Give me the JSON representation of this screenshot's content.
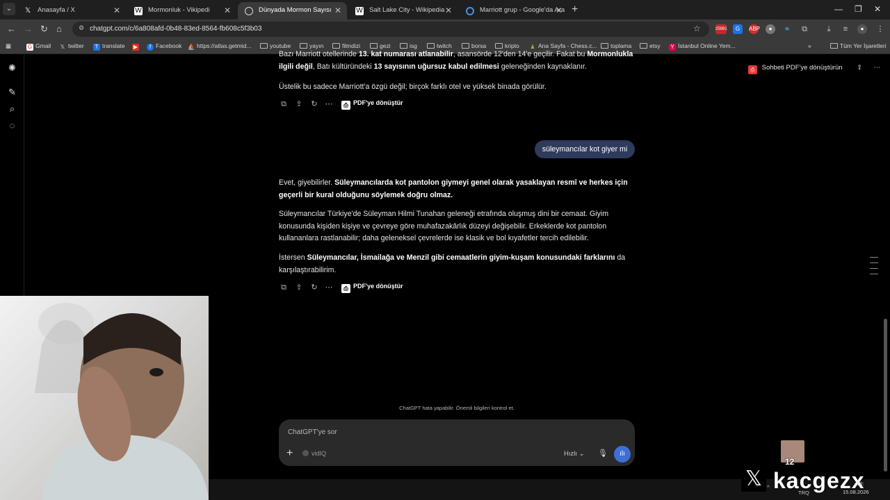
{
  "browser": {
    "tabs": [
      {
        "title": "Anasayfa / X",
        "favicon": "x-logo-icon",
        "active": false
      },
      {
        "title": "Mormonluk - Vikipedi",
        "favicon": "wikipedia-icon",
        "active": false
      },
      {
        "title": "Dünyada Mormon Sayısı",
        "favicon": "chatgpt-icon",
        "active": true
      },
      {
        "title": "Salt Lake City - Wikipedia",
        "favicon": "wikipedia-icon",
        "active": false
      },
      {
        "title": "Marriott grup - Google'da Ara",
        "favicon": "google-icon",
        "active": false
      }
    ],
    "url": "chatgpt.com/c/6a808afd-0b48-83ed-8564-fb608c5f3b03",
    "badge_count": "25981",
    "bookmarks": [
      {
        "label": "Gmail",
        "icon": "gmail-icon"
      },
      {
        "label": "twitter",
        "icon": "x-logo-icon"
      },
      {
        "label": "translate",
        "icon": "translate-icon"
      },
      {
        "label": "",
        "icon": "youtube-icon"
      },
      {
        "label": "Facebook",
        "icon": "facebook-icon"
      },
      {
        "label": "https://atlas.getmid...",
        "icon": "midjourney-icon"
      },
      {
        "label": "youtube",
        "icon": "folder-icon"
      },
      {
        "label": "yayın",
        "icon": "folder-icon"
      },
      {
        "label": "filmdizi",
        "icon": "folder-icon"
      },
      {
        "label": "gezi",
        "icon": "folder-icon"
      },
      {
        "label": "isg",
        "icon": "folder-icon"
      },
      {
        "label": "twitch",
        "icon": "folder-icon"
      },
      {
        "label": "borsa",
        "icon": "folder-icon"
      },
      {
        "label": "kripto",
        "icon": "folder-icon"
      },
      {
        "label": "Ana Sayfa - Chess.c...",
        "icon": "chess-icon"
      },
      {
        "label": "toplama",
        "icon": "folder-icon"
      },
      {
        "label": "etsy",
        "icon": "folder-icon"
      },
      {
        "label": "İstanbul Online Yem...",
        "icon": "yemeksepeti-icon"
      }
    ],
    "all_bookmarks": "Tüm Yer İşaretleri"
  },
  "chat": {
    "top_clipped_html_a": "Bazı Marriott otellerinde ",
    "top_clipped_b1": "13. kat numarası atlanabilir",
    "top_clipped_c": ", asansörde 12'den 14'e geçilir. Fakat bu ",
    "top_clipped_b2": "Mormonlukla",
    "line2_b1": "ilgili değil",
    "line2_c": ", Batı kültüründeki ",
    "line2_b2": "13 sayısının uğursuz kabul edilmesi",
    "line2_d": " geleneğinden kaynaklanır.",
    "prev_para2": "Üstelik bu sadece Marriott'a özgü değil; birçok farklı otel ve yüksek binada görülür.",
    "pdf_label": "PDF'ye dönüştür",
    "user_message": "süleymancılar kot giyer mi",
    "answer": {
      "p1_a": "Evet, giyebilirler. ",
      "p1_b": "Süleymancılarda kot pantolon giymeyi genel olarak yasaklayan resmî ve herkes için geçerli bir kural olduğunu söylemek doğru olmaz.",
      "p2": "Süleymancılar Türkiye'de Süleyman Hilmi Tunahan geleneği etrafında oluşmuş dini bir cemaat. Giyim konusunda kişiden kişiye ve çevreye göre muhafazakârlık düzeyi değişebilir. Erkeklerde kot pantolon kullananlara rastlanabilir; daha geleneksel çevrelerde ise klasik ve bol kıyafetler tercih edilebilir.",
      "p3_a": "İstersen ",
      "p3_b": "Süleymancılar, İsmailağa ve Menzil gibi cemaatlerin giyim-kuşam konusundaki farklarını",
      "p3_c": " da karşılaştırabilirim."
    },
    "export_pdf": "Sohbeti PDF'ye dönüştürün",
    "disclaimer": "ChatGPT hata yapabilir. Önemli bilgileri kontrol et.",
    "composer_placeholder": "ChatGPT'ye sor",
    "tool_label": "vidIQ",
    "speed_label": "Hızlı"
  },
  "overlay": {
    "brand": "kacgezx",
    "sticker_number": "12",
    "tray_lang": "TRQ",
    "clock_time": "18:",
    "clock_date": "15.08.2026"
  }
}
